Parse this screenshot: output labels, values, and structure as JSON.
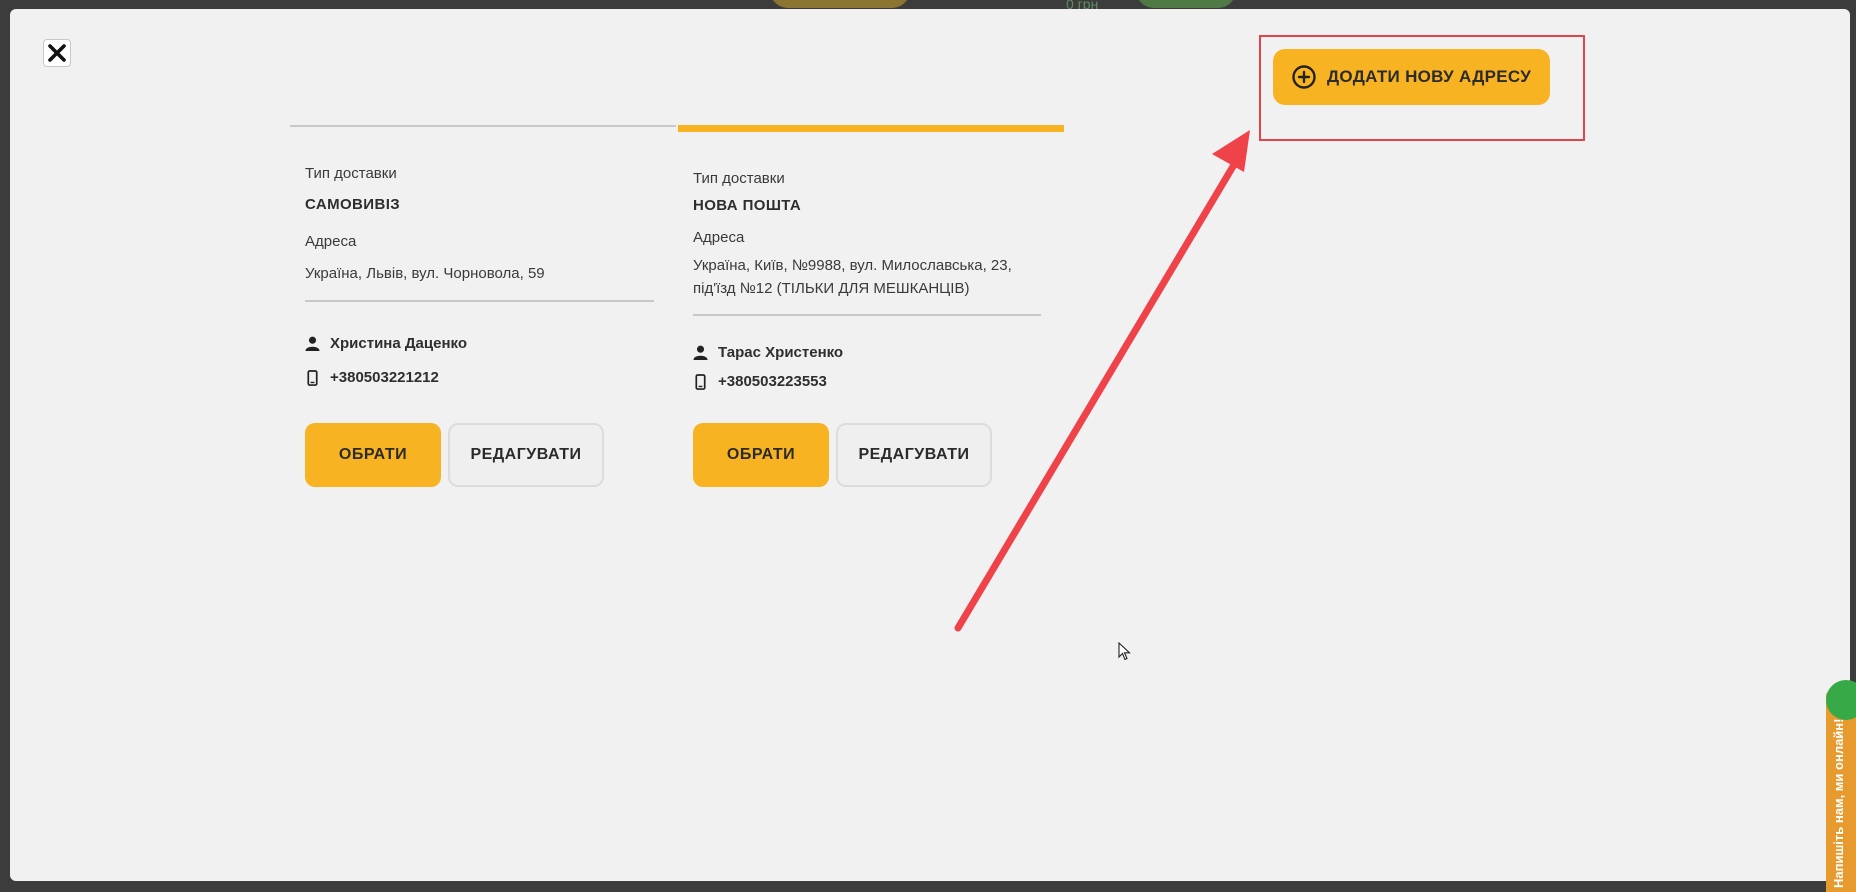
{
  "background": {
    "price_fragment": "0 грн"
  },
  "modal": {
    "close_label": "✕",
    "add_button": {
      "label": "ДОДАТИ НОВУ АДРЕСУ",
      "icon": "plus-circle-icon"
    },
    "cards": [
      {
        "delivery_type_label": "Тип доставки",
        "delivery_type": "САМОВИВІЗ",
        "address_label": "Адреса",
        "address": "Україна, Львів, вул. Чорновола, 59",
        "name": "Христина Даценко",
        "phone": "+380503221212",
        "choose_label": "ОБРАТИ",
        "edit_label": "РЕДАГУВАТИ",
        "selected": false
      },
      {
        "delivery_type_label": "Тип доставки",
        "delivery_type": "НОВА ПОШТА",
        "address_label": "Адреса",
        "address_line1": "Україна, Київ, №9988, вул. Милославська, 23,",
        "address_line2": "під'їзд №12 (ТІЛЬКИ ДЛЯ МЕШКАНЦІВ)",
        "name": "Тарас Христенко",
        "phone": "+380503223553",
        "choose_label": "ОБРАТИ",
        "edit_label": "РЕДАГУВАТИ",
        "selected": true
      }
    ]
  },
  "chat_widget": {
    "label": "Напишіть нам, ми онлайн!"
  },
  "colors": {
    "accent": "#f7b322",
    "modal_bg": "#f1f1f1",
    "highlight": "#e0454d",
    "chat": "#e79a2e"
  }
}
